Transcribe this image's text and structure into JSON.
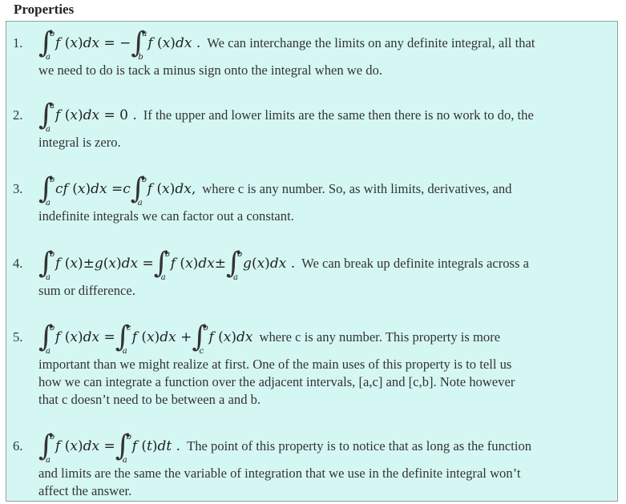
{
  "heading": "Properties",
  "items": [
    {
      "num": "1.",
      "text1": "We can interchange the limits on any definite integral, all that",
      "text2": "we need to do is tack a minus sign onto the integral when we do."
    },
    {
      "num": "2.",
      "text1": "If the upper and lower limits are the same then there is no work to do, the",
      "text2": "integral is zero."
    },
    {
      "num": "3.",
      "text1": "where c is any number.  So, as with limits, derivatives, and",
      "text2": "indefinite integrals we can factor out a constant."
    },
    {
      "num": "4.",
      "text1": "We can break up definite integrals across a",
      "text2": "sum or difference."
    },
    {
      "num": "5.",
      "text1": "where c is any number.  This property is more",
      "text2": "important than we might realize at first.  One of the main uses of this property is to tell us",
      "text3": "how we can integrate a function over the adjacent intervals, [a,c] and [c,b].  Note however",
      "text4": "that c doesn’t need to be between a and b."
    },
    {
      "num": "6.",
      "text1": "The point of this property is to notice that as long as the function",
      "text2": "and limits are the same the variable of integration that we use in the definite integral won’t",
      "text3": "affect the answer."
    }
  ]
}
